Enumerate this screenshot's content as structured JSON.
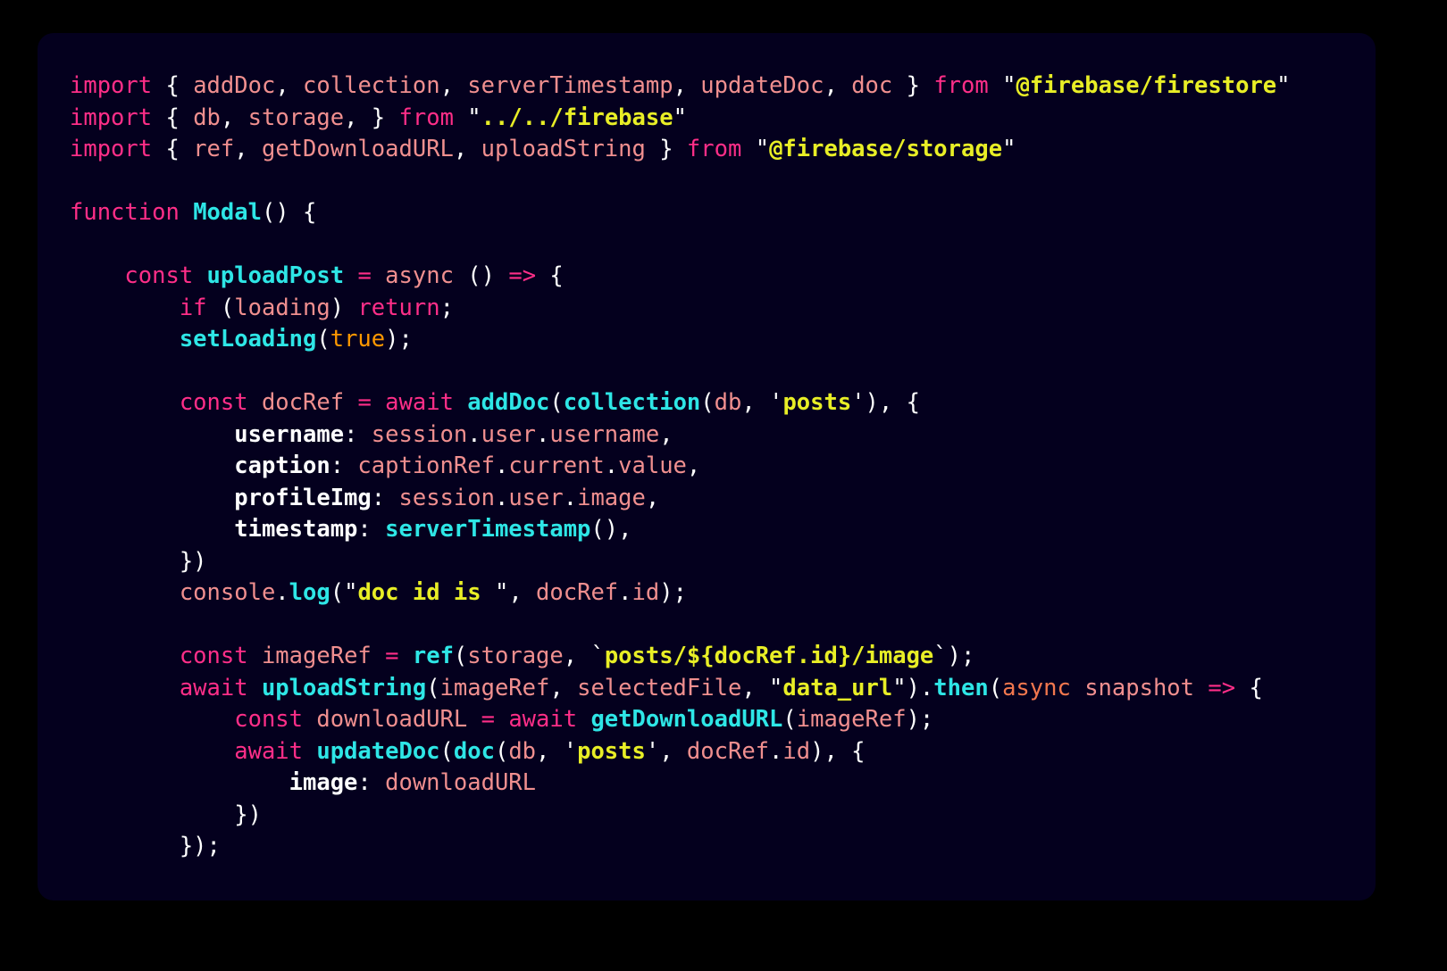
{
  "window": {
    "background": "#000000",
    "panel_background": "#04001e",
    "panel_radius": "18px"
  },
  "palette": {
    "keyword": "#ff2e88",
    "identifier": "#f08f8f",
    "function": "#2ee6e6",
    "string": "#e8ee26",
    "punctuation": "#ffffff",
    "object_key": "#ffffff",
    "boolean": "#ff9800",
    "async_callback": "#f2774e"
  },
  "code": {
    "language": "javascript",
    "lines": [
      "import { addDoc, collection, serverTimestamp, updateDoc, doc } from \"@firebase/firestore\"",
      "import { db, storage, } from \"../../firebase\"",
      "import { ref, getDownloadURL, uploadString } from \"@firebase/storage\"",
      "",
      "function Modal() {",
      "",
      "    const uploadPost = async () => {",
      "        if (loading) return;",
      "        setLoading(true);",
      "",
      "        const docRef = await addDoc(collection(db, 'posts'), {",
      "            username: session.user.username,",
      "            caption: captionRef.current.value,",
      "            profileImg: session.user.image,",
      "            timestamp: serverTimestamp(),",
      "        })",
      "        console.log(\"doc id is \", docRef.id);",
      "",
      "        const imageRef = ref(storage, `posts/${docRef.id}/image`);",
      "        await uploadString(imageRef, selectedFile, \"data_url\").then(async snapshot => {",
      "            const downloadURL = await getDownloadURL(imageRef);",
      "            await updateDoc(doc(db, 'posts', docRef.id), {",
      "                image: downloadURL",
      "            })",
      "        });"
    ],
    "tokens": [
      [
        [
          "kw",
          "import"
        ],
        [
          "pun",
          " { "
        ],
        [
          "var",
          "addDoc"
        ],
        [
          "pun",
          ", "
        ],
        [
          "var",
          "collection"
        ],
        [
          "pun",
          ", "
        ],
        [
          "var",
          "serverTimestamp"
        ],
        [
          "pun",
          ", "
        ],
        [
          "var",
          "updateDoc"
        ],
        [
          "pun",
          ", "
        ],
        [
          "var",
          "doc"
        ],
        [
          "pun",
          " } "
        ],
        [
          "kw",
          "from"
        ],
        [
          "pun",
          " \""
        ],
        [
          "str",
          "@firebase/firestore"
        ],
        [
          "pun",
          "\""
        ]
      ],
      [
        [
          "kw",
          "import"
        ],
        [
          "pun",
          " { "
        ],
        [
          "var",
          "db"
        ],
        [
          "pun",
          ", "
        ],
        [
          "var",
          "storage"
        ],
        [
          "pun",
          ", } "
        ],
        [
          "kw",
          "from"
        ],
        [
          "pun",
          " \""
        ],
        [
          "str",
          "../../firebase"
        ],
        [
          "pun",
          "\""
        ]
      ],
      [
        [
          "kw",
          "import"
        ],
        [
          "pun",
          " { "
        ],
        [
          "var",
          "ref"
        ],
        [
          "pun",
          ", "
        ],
        [
          "var",
          "getDownloadURL"
        ],
        [
          "pun",
          ", "
        ],
        [
          "var",
          "uploadString"
        ],
        [
          "pun",
          " } "
        ],
        [
          "kw",
          "from"
        ],
        [
          "pun",
          " \""
        ],
        [
          "str",
          "@firebase/storage"
        ],
        [
          "pun",
          "\""
        ]
      ],
      [],
      [
        [
          "kw",
          "function"
        ],
        [
          "pun",
          " "
        ],
        [
          "fn",
          "Modal"
        ],
        [
          "pun",
          "() {"
        ]
      ],
      [],
      [
        [
          "pun",
          "    "
        ],
        [
          "kw",
          "const"
        ],
        [
          "pun",
          " "
        ],
        [
          "fn",
          "uploadPost"
        ],
        [
          "pun",
          " "
        ],
        [
          "kw",
          "="
        ],
        [
          "pun",
          " "
        ],
        [
          "var",
          "async"
        ],
        [
          "pun",
          " () "
        ],
        [
          "kw",
          "=>"
        ],
        [
          "pun",
          " {"
        ]
      ],
      [
        [
          "pun",
          "        "
        ],
        [
          "kw",
          "if"
        ],
        [
          "pun",
          " ("
        ],
        [
          "var",
          "loading"
        ],
        [
          "pun",
          ") "
        ],
        [
          "kw",
          "return"
        ],
        [
          "pun",
          ";"
        ]
      ],
      [
        [
          "pun",
          "        "
        ],
        [
          "fn",
          "setLoading"
        ],
        [
          "pun",
          "("
        ],
        [
          "bool",
          "true"
        ],
        [
          "pun",
          ");"
        ]
      ],
      [],
      [
        [
          "pun",
          "        "
        ],
        [
          "kw",
          "const"
        ],
        [
          "pun",
          " "
        ],
        [
          "var",
          "docRef"
        ],
        [
          "pun",
          " "
        ],
        [
          "kw",
          "="
        ],
        [
          "pun",
          " "
        ],
        [
          "kw",
          "await"
        ],
        [
          "pun",
          " "
        ],
        [
          "fn",
          "addDoc"
        ],
        [
          "pun",
          "("
        ],
        [
          "fn",
          "collection"
        ],
        [
          "pun",
          "("
        ],
        [
          "var",
          "db"
        ],
        [
          "pun",
          ", '"
        ],
        [
          "str",
          "posts"
        ],
        [
          "pun",
          "'), {"
        ]
      ],
      [
        [
          "pun",
          "            "
        ],
        [
          "key",
          "username"
        ],
        [
          "pun",
          ": "
        ],
        [
          "var",
          "session"
        ],
        [
          "pun",
          "."
        ],
        [
          "var",
          "user"
        ],
        [
          "pun",
          "."
        ],
        [
          "var",
          "username"
        ],
        [
          "pun",
          ","
        ]
      ],
      [
        [
          "pun",
          "            "
        ],
        [
          "key",
          "caption"
        ],
        [
          "pun",
          ": "
        ],
        [
          "var",
          "captionRef"
        ],
        [
          "pun",
          "."
        ],
        [
          "var",
          "current"
        ],
        [
          "pun",
          "."
        ],
        [
          "var",
          "value"
        ],
        [
          "pun",
          ","
        ]
      ],
      [
        [
          "pun",
          "            "
        ],
        [
          "key",
          "profileImg"
        ],
        [
          "pun",
          ": "
        ],
        [
          "var",
          "session"
        ],
        [
          "pun",
          "."
        ],
        [
          "var",
          "user"
        ],
        [
          "pun",
          "."
        ],
        [
          "var",
          "image"
        ],
        [
          "pun",
          ","
        ]
      ],
      [
        [
          "pun",
          "            "
        ],
        [
          "key",
          "timestamp"
        ],
        [
          "pun",
          ": "
        ],
        [
          "fn",
          "serverTimestamp"
        ],
        [
          "pun",
          "(),"
        ]
      ],
      [
        [
          "pun",
          "        })"
        ]
      ],
      [
        [
          "pun",
          "        "
        ],
        [
          "var",
          "console"
        ],
        [
          "pun",
          "."
        ],
        [
          "fn",
          "log"
        ],
        [
          "pun",
          "(\""
        ],
        [
          "str",
          "doc id is "
        ],
        [
          "pun",
          "\", "
        ],
        [
          "var",
          "docRef"
        ],
        [
          "pun",
          "."
        ],
        [
          "var",
          "id"
        ],
        [
          "pun",
          ");"
        ]
      ],
      [],
      [
        [
          "pun",
          "        "
        ],
        [
          "kw",
          "const"
        ],
        [
          "pun",
          " "
        ],
        [
          "var",
          "imageRef"
        ],
        [
          "pun",
          " "
        ],
        [
          "kw",
          "="
        ],
        [
          "pun",
          " "
        ],
        [
          "fn",
          "ref"
        ],
        [
          "pun",
          "("
        ],
        [
          "var",
          "storage"
        ],
        [
          "pun",
          ", `"
        ],
        [
          "str",
          "posts/${docRef.id}/image"
        ],
        [
          "pun",
          "`);"
        ]
      ],
      [
        [
          "pun",
          "        "
        ],
        [
          "kw",
          "await"
        ],
        [
          "pun",
          " "
        ],
        [
          "fn",
          "uploadString"
        ],
        [
          "pun",
          "("
        ],
        [
          "var",
          "imageRef"
        ],
        [
          "pun",
          ", "
        ],
        [
          "var",
          "selectedFile"
        ],
        [
          "pun",
          ", \""
        ],
        [
          "str",
          "data_url"
        ],
        [
          "pun",
          "\")."
        ],
        [
          "fn",
          "then"
        ],
        [
          "pun",
          "("
        ],
        [
          "asy",
          "async"
        ],
        [
          "pun",
          " "
        ],
        [
          "var",
          "snapshot"
        ],
        [
          "pun",
          " "
        ],
        [
          "kw",
          "=>"
        ],
        [
          "pun",
          " {"
        ]
      ],
      [
        [
          "pun",
          "            "
        ],
        [
          "kw",
          "const"
        ],
        [
          "pun",
          " "
        ],
        [
          "var",
          "downloadURL"
        ],
        [
          "pun",
          " "
        ],
        [
          "kw",
          "="
        ],
        [
          "pun",
          " "
        ],
        [
          "kw",
          "await"
        ],
        [
          "pun",
          " "
        ],
        [
          "fn",
          "getDownloadURL"
        ],
        [
          "pun",
          "("
        ],
        [
          "var",
          "imageRef"
        ],
        [
          "pun",
          ");"
        ]
      ],
      [
        [
          "pun",
          "            "
        ],
        [
          "kw",
          "await"
        ],
        [
          "pun",
          " "
        ],
        [
          "fn",
          "updateDoc"
        ],
        [
          "pun",
          "("
        ],
        [
          "fn",
          "doc"
        ],
        [
          "pun",
          "("
        ],
        [
          "var",
          "db"
        ],
        [
          "pun",
          ", '"
        ],
        [
          "str",
          "posts"
        ],
        [
          "pun",
          "', "
        ],
        [
          "var",
          "docRef"
        ],
        [
          "pun",
          "."
        ],
        [
          "var",
          "id"
        ],
        [
          "pun",
          "), {"
        ]
      ],
      [
        [
          "pun",
          "                "
        ],
        [
          "key",
          "image"
        ],
        [
          "pun",
          ": "
        ],
        [
          "var",
          "downloadURL"
        ]
      ],
      [
        [
          "pun",
          "            })"
        ]
      ],
      [
        [
          "pun",
          "        });"
        ]
      ]
    ]
  }
}
